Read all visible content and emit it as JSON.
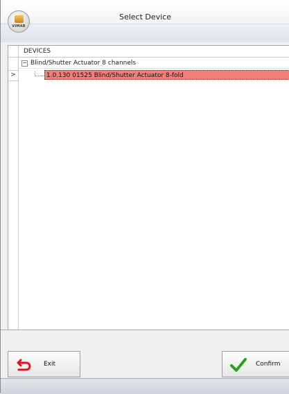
{
  "window": {
    "title": "Select Device",
    "logo_text": "VIMAR"
  },
  "tree": {
    "column_header": "DEVICES",
    "row_indicator": ">",
    "expander_symbol": "−",
    "group_label": "Blind/Shutter Actuator 8 channels",
    "selected_item_label": "1.0.130 01525 Blind/Shutter Actuator 8-fold"
  },
  "buttons": {
    "exit_label": "Exit",
    "confirm_label": "Confirm"
  },
  "colors": {
    "selected_row": "#f08078",
    "exit_icon": "#e4101a",
    "confirm_icon": "#2aa11b"
  },
  "icons": {
    "exit": "undo-arrow-icon",
    "confirm": "checkmark-icon",
    "logo": "vimar-logo-icon"
  }
}
